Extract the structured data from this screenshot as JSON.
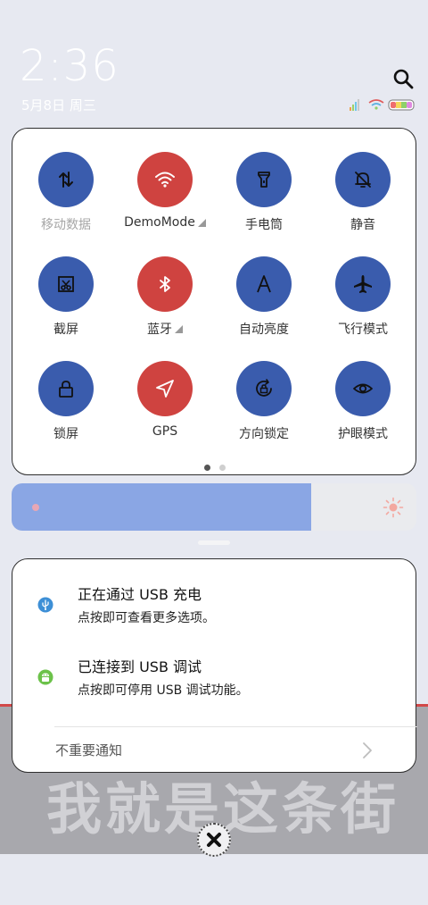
{
  "status": {
    "time": "2:36",
    "date": "5月8日 周三"
  },
  "quick_settings": {
    "tiles": [
      {
        "label": "移动数据",
        "icon": "mobile-data-icon",
        "active": false,
        "dim": true,
        "expandable": false
      },
      {
        "label": "DemoMode",
        "icon": "wifi-icon",
        "active": true,
        "dim": false,
        "expandable": true
      },
      {
        "label": "手电筒",
        "icon": "flashlight-icon",
        "active": false,
        "dim": false,
        "expandable": false
      },
      {
        "label": "静音",
        "icon": "mute-bell-icon",
        "active": false,
        "dim": false,
        "expandable": false
      },
      {
        "label": "截屏",
        "icon": "screenshot-icon",
        "active": false,
        "dim": false,
        "expandable": false
      },
      {
        "label": "蓝牙",
        "icon": "bluetooth-icon",
        "active": true,
        "dim": false,
        "expandable": true
      },
      {
        "label": "自动亮度",
        "icon": "auto-brightness-icon",
        "active": false,
        "dim": false,
        "expandable": false
      },
      {
        "label": "飞行模式",
        "icon": "airplane-icon",
        "active": false,
        "dim": false,
        "expandable": false
      },
      {
        "label": "锁屏",
        "icon": "lock-icon",
        "active": false,
        "dim": false,
        "expandable": false
      },
      {
        "label": "GPS",
        "icon": "location-arrow-icon",
        "active": true,
        "dim": false,
        "expandable": false
      },
      {
        "label": "方向锁定",
        "icon": "rotation-lock-icon",
        "active": false,
        "dim": false,
        "expandable": false
      },
      {
        "label": "护眼模式",
        "icon": "eye-icon",
        "active": false,
        "dim": false,
        "expandable": false
      }
    ],
    "page_count": 2,
    "current_page": 1
  },
  "brightness": {
    "level": 0.74
  },
  "notifications": [
    {
      "title": "正在通过 USB 充电",
      "body": "点按即可查看更多选项。",
      "icon": "usb-icon"
    },
    {
      "title": "已连接到 USB 调试",
      "body": "点按即可停用 USB 调试功能。",
      "icon": "android-icon"
    }
  ],
  "unimportant_label": "不重要通知",
  "wallpaper_text": "我就是这条街",
  "colors": {
    "tile_inactive": "#3a5cad",
    "tile_active": "#cf4340",
    "brightness_fill": "#8aa6e4"
  }
}
